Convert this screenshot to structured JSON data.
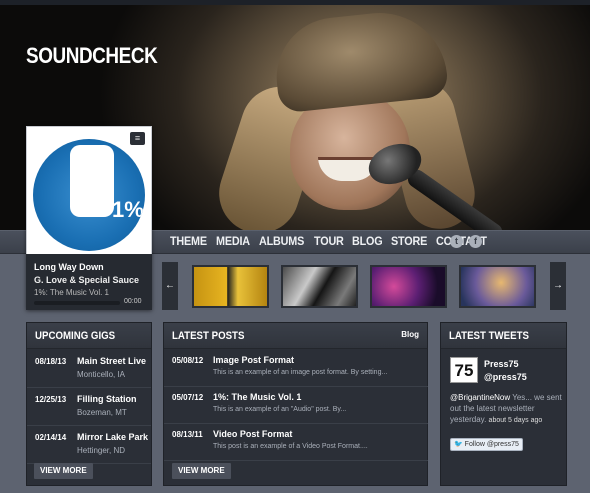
{
  "site": {
    "logo": "SOUNDCHECK"
  },
  "nav": {
    "items": [
      {
        "label": "THEME"
      },
      {
        "label": "MEDIA"
      },
      {
        "label": "ALBUMS"
      },
      {
        "label": "TOUR"
      },
      {
        "label": "BLOG"
      },
      {
        "label": "STORE"
      },
      {
        "label": "CONTACT"
      }
    ],
    "social_icons": [
      "twitter-icon",
      "facebook-icon"
    ]
  },
  "player": {
    "album_cover_text": "1%",
    "track": "Long Way Down",
    "artist": "G. Love & Special Sauce",
    "album": "1%: The Music Vol. 1",
    "time": "00:00"
  },
  "carousel": {
    "prev_icon": "←",
    "next_icon": "→"
  },
  "gigs": {
    "title": "UPCOMING GIGS",
    "items": [
      {
        "date": "08/18/13",
        "venue": "Main Street Live",
        "city": "Monticello, IA"
      },
      {
        "date": "12/25/13",
        "venue": "Filling Station",
        "city": "Bozeman, MT"
      },
      {
        "date": "02/14/14",
        "venue": "Mirror Lake Park",
        "city": "Hettinger, ND"
      }
    ],
    "button": "VIEW MORE"
  },
  "posts": {
    "title": "LATEST POSTS",
    "blog_link": "Blog",
    "items": [
      {
        "date": "05/08/12",
        "title": "Image Post Format",
        "excerpt": "This is an example of an image post format. By setting..."
      },
      {
        "date": "05/07/12",
        "title": "1%: The Music Vol. 1",
        "excerpt": "This is an example of an \"Audio\" post. By..."
      },
      {
        "date": "08/13/11",
        "title": "Video Post Format",
        "excerpt": "This post is an example of a Video Post Format...."
      }
    ],
    "button": "VIEW MORE"
  },
  "tweets": {
    "title": "LATEST TWEETS",
    "avatar_text": "75",
    "name": "Press75",
    "handle": "@press75",
    "mention": "@BrigantineNow",
    "text": " Yes... we sent out the latest newsletter yesterday.",
    "time": "about 5 days ago",
    "follow_button": "Follow @press75"
  },
  "colors": {
    "page_bg": "#5d6370",
    "panel_bg": "#2b2f37",
    "accent_blue": "#1a6fb3"
  }
}
